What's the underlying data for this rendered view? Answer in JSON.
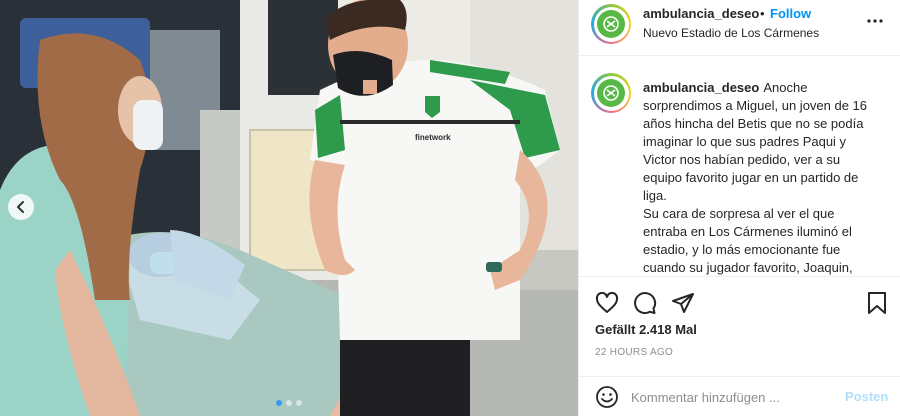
{
  "post": {
    "username": "ambulancia_deseo",
    "separator": "•",
    "follow_label": "Follow",
    "location": "Nuevo Estadio de Los Cármenes",
    "more_icon": "more-horizontal-icon",
    "brand_colors": {
      "follow": "#0095f6",
      "avatar_core": "#57b846"
    }
  },
  "caption": {
    "username": "ambulancia_deseo",
    "paragraph1": "Anoche sorprendimos a Miguel, un joven de 16 años hincha del Betis que no se podía imaginar lo que sus padres Paqui y Victor nos habían pedido, ver a su equipo favorito jugar en un partido de liga.",
    "paragraph2": "Su cara de sorpresa al ver el que entraba en Los Cármenes iluminó el estadio, y lo más emocionante fue cuando su jugador favorito, Joaquin,"
  },
  "photo": {
    "jersey_sponsor": "finetwork",
    "carousel_prev_icon": "chevron-left-icon",
    "carousel_count": 3,
    "carousel_active_index": 1
  },
  "actions": {
    "icons": [
      "heart-icon",
      "comment-icon",
      "share-icon",
      "bookmark-icon"
    ],
    "likes_text": "Gefällt 2.418 Mal",
    "timestamp": "22 HOURS AGO"
  },
  "comment": {
    "placeholder": "Kommentar hinzufügen ...",
    "post_label": "Posten",
    "emoji_icon": "emoji-icon"
  }
}
